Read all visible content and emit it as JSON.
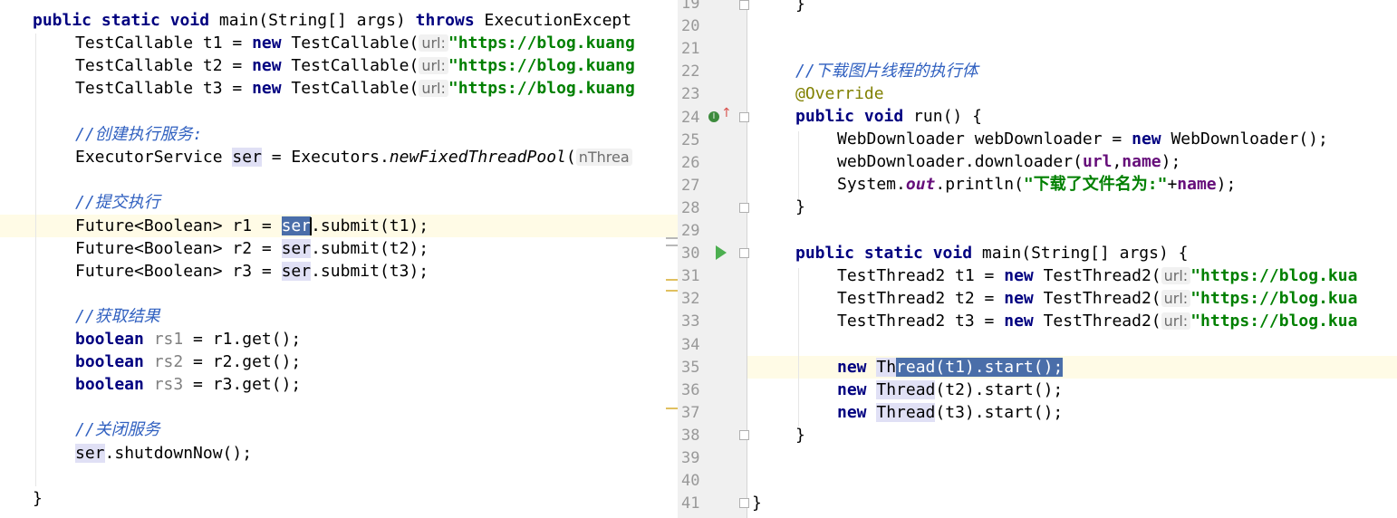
{
  "left": {
    "l1": {
      "kw1": "public static void",
      "a": " main(String[] args) ",
      "kw2": "throws",
      "b": " ExecutionExcept"
    },
    "t1": {
      "a": "TestCallable t1 = ",
      "kw": "new",
      "b": " TestCallable(",
      "hint": "url:",
      "str": "\"https://blog.kuang"
    },
    "t2": {
      "a": "TestCallable t2 = ",
      "kw": "new",
      "b": " TestCallable(",
      "hint": "url:",
      "str": "\"https://blog.kuang"
    },
    "t3": {
      "a": "TestCallable t3 = ",
      "kw": "new",
      "b": " TestCallable(",
      "hint": "url:",
      "str": "\"https://blog.kuang"
    },
    "c1": "//创建执行服务:",
    "exec": {
      "a": "ExecutorService ",
      "var": "ser",
      "b": " = Executors.",
      "m": "newFixedThreadPool",
      "c": "(",
      "hint": "nThrea"
    },
    "c2": "//提交执行",
    "r1": {
      "a": "Future<Boolean> r1 = ",
      "var": "ser",
      "b": ".submit(t1);"
    },
    "r2": {
      "a": "Future<Boolean> r2 = ",
      "var": "ser",
      "b": ".submit(t2);"
    },
    "r3": {
      "a": "Future<Boolean> r3 = ",
      "var": "ser",
      "b": ".submit(t3);"
    },
    "c3": "//获取结果",
    "g1": {
      "kw": "boolean",
      "v": " rs1",
      "b": " = r1.get();"
    },
    "g2": {
      "kw": "boolean",
      "v": " rs2",
      "b": " = r2.get();"
    },
    "g3": {
      "kw": "boolean",
      "v": " rs3",
      "b": " = r3.get();"
    },
    "c4": "//关闭服务",
    "sd": {
      "var": "ser",
      "b": ".shutdownNow();"
    },
    "close": "}"
  },
  "right": {
    "line_numbers": [
      "19",
      "20",
      "21",
      "22",
      "23",
      "24",
      "25",
      "26",
      "27",
      "28",
      "29",
      "30",
      "31",
      "32",
      "33",
      "34",
      "35",
      "36",
      "37",
      "38",
      "39",
      "40",
      "41"
    ],
    "l19": "}",
    "l22": "//下载图片线程的执行体",
    "l23": "@Override",
    "l24": {
      "kw": "public void",
      "b": " run() {"
    },
    "l25": {
      "a": "WebDownloader webDownloader = ",
      "kw": "new",
      "b": " WebDownloader();"
    },
    "l26": {
      "a": "webDownloader.downloader(",
      "p1": "url",
      "c": ",",
      "p2": "name",
      "d": ");"
    },
    "l27": {
      "a": "System.",
      "f": "out",
      "b": ".println(",
      "str": "\"下载了文件名为:\"",
      "c": "+",
      "p": "name",
      "d": ");"
    },
    "l28": "}",
    "l30": {
      "kw": "public static void",
      "b": " main(String[] args) {"
    },
    "l31": {
      "a": "TestThread2 t1 = ",
      "kw": "new",
      "b": " TestThread2(",
      "hint": "url:",
      "str": "\"https://blog.kua"
    },
    "l32": {
      "a": "TestThread2 t2 = ",
      "kw": "new",
      "b": " TestThread2(",
      "hint": "url:",
      "str": "\"https://blog.kua"
    },
    "l33": {
      "a": "TestThread2 t3 = ",
      "kw": "new",
      "b": " TestThread2(",
      "hint": "url:",
      "str": "\"https://blog.kua"
    },
    "l35": {
      "kw": "new",
      "s1": " ",
      "u": "Th",
      "sel": "read(t1).start();"
    },
    "l36": {
      "kw": "new",
      "s1": " ",
      "u": "Thread",
      "b": "(t2).start();"
    },
    "l37": {
      "kw": "new",
      "s1": " ",
      "u": "Thread",
      "b": "(t3).start();"
    },
    "l38": "}",
    "l41": "}"
  },
  "icons": {
    "run": "run-gutter-icon",
    "impl": "implements-gutter-icon"
  },
  "colors": {
    "keyword": "#000080",
    "string": "#008000",
    "comment": "#3060c0",
    "annotation": "#808000",
    "selection": "#4a6ea9",
    "field": "#660e7a"
  }
}
